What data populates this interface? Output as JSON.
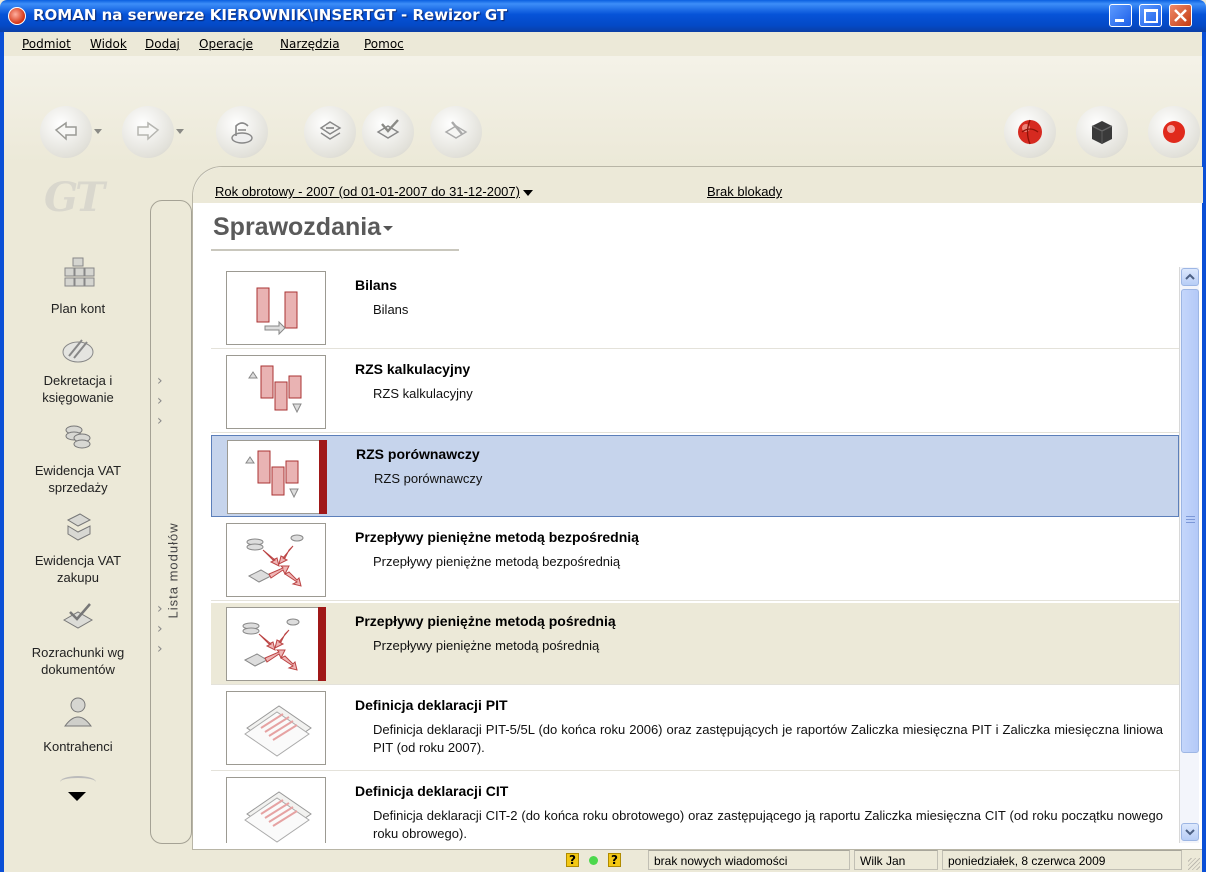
{
  "window": {
    "title": "ROMAN na serwerze KIEROWNIK\\INSERTGT - Rewizor GT",
    "colors": {
      "title_bar": "#0A5FE0",
      "close_button": "#C23B12",
      "selection": "#C6D4EC",
      "marker": "#A01818"
    }
  },
  "menu": {
    "items": [
      {
        "label": "Podmiot"
      },
      {
        "label": "Widok"
      },
      {
        "label": "Dodaj"
      },
      {
        "label": "Operacje"
      },
      {
        "label": "Narzędzia"
      },
      {
        "label": "Pomoc"
      }
    ]
  },
  "toolbar": {
    "buttons": [
      {
        "icon": "back-arrow-icon",
        "has_dropdown": true
      },
      {
        "icon": "forward-arrow-icon",
        "has_dropdown": true
      },
      {
        "icon": "cash-register-icon"
      },
      {
        "icon": "documents-icon"
      },
      {
        "icon": "check-documents-icon"
      },
      {
        "icon": "document-edit-icon"
      }
    ],
    "right_buttons": [
      {
        "icon": "globe-icon"
      },
      {
        "icon": "box-icon"
      },
      {
        "icon": "record-icon"
      }
    ]
  },
  "sidebar": {
    "logo": "GT",
    "items": [
      {
        "label_1": "Plan kont",
        "label_2": "",
        "icon": "plan-kont-icon"
      },
      {
        "label_1": "Dekretacja i",
        "label_2": "księgowanie",
        "icon": "dekretacja-icon"
      },
      {
        "label_1": "Ewidencja VAT",
        "label_2": "sprzedaży",
        "icon": "vat-sprzedaz-icon"
      },
      {
        "label_1": "Ewidencja VAT",
        "label_2": "zakupu",
        "icon": "vat-zakup-icon"
      },
      {
        "label_1": "Rozrachunki wg",
        "label_2": "dokumentów",
        "icon": "rozrachunki-icon"
      },
      {
        "label_1": "Kontrahenci",
        "label_2": "",
        "icon": "kontrahenci-icon"
      }
    ],
    "module_strip_label": "Lista modułów"
  },
  "header": {
    "fiscal_year": "Rok obrotowy - 2007  (od 01-01-2007 do 31-12-2007)",
    "lock_status": "Brak blokady"
  },
  "page": {
    "title": "Sprawozdania"
  },
  "reports": [
    {
      "title": "Bilans",
      "description": "Bilans",
      "thumb": "bilans-icon",
      "marked": false
    },
    {
      "title": "RZS kalkulacyjny",
      "description": "RZS kalkulacyjny",
      "thumb": "rzs-icon",
      "marked": false
    },
    {
      "title": "RZS porównawczy",
      "description": "RZS porównawczy",
      "thumb": "rzs-icon",
      "marked": true,
      "selected": true
    },
    {
      "title": "Przepływy pieniężne metodą bezpośrednią",
      "description": "Przepływy pieniężne metodą bezpośrednią",
      "thumb": "cashflow-icon",
      "marked": false
    },
    {
      "title": "Przepływy pieniężne metodą pośrednią",
      "description": "Przepływy pieniężne metodą pośrednią",
      "thumb": "cashflow-icon",
      "marked": true
    },
    {
      "title": "Definicja deklaracji PIT",
      "description": "Definicja deklaracji PIT-5/5L (do końca roku 2006) oraz zastępujących je raportów Zaliczka miesięczna PIT i Zaliczka miesięczna liniowa PIT (od roku 2007).",
      "thumb": "declaration-icon",
      "marked": false
    },
    {
      "title": "Definicja deklaracji CIT",
      "description": "Definicja deklaracji CIT-2 (do końca roku obrotowego) oraz zastępującego ją raportu Zaliczka miesięczna CIT (od roku początku nowego roku obrowego).",
      "thumb": "declaration-icon",
      "marked": false
    }
  ],
  "status": {
    "messages": "brak nowych wiadomości",
    "user": "Wilk Jan",
    "date": "poniedziałek, 8 czerwca 2009",
    "help_glyph": "?"
  }
}
